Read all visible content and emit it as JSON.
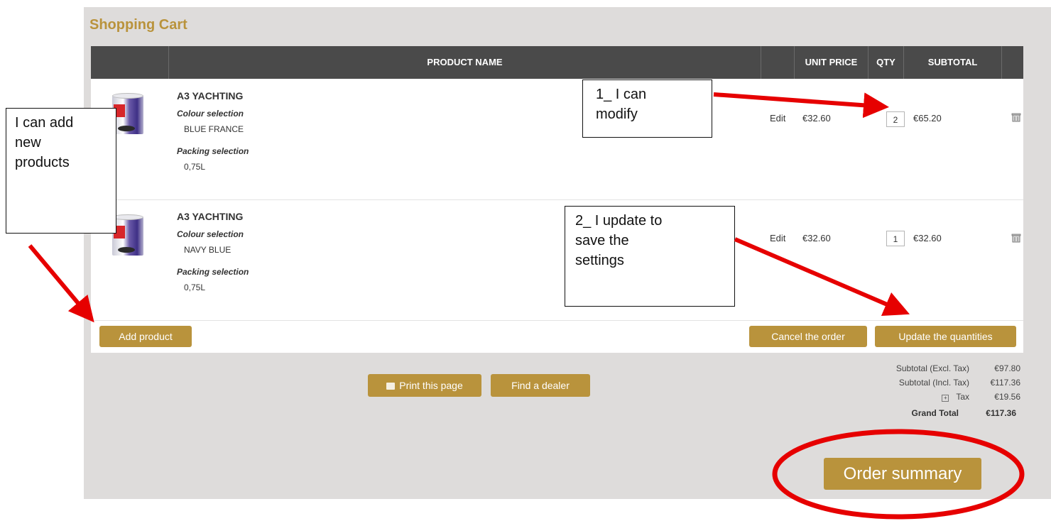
{
  "page": {
    "title": "Shopping Cart"
  },
  "table": {
    "headers": {
      "product_name": "PRODUCT NAME",
      "unit_price": "UNIT PRICE",
      "qty": "QTY",
      "subtotal": "SUBTOTAL"
    },
    "rows": [
      {
        "name": "A3 YACHTING",
        "colour_label": "Colour selection",
        "colour_value": "BLUE FRANCE",
        "packing_label": "Packing selection",
        "packing_value": "0,75L",
        "edit": "Edit",
        "unit_price": "€32.60",
        "qty": "2",
        "subtotal": "€65.20"
      },
      {
        "name": "A3 YACHTING",
        "colour_label": "Colour selection",
        "colour_value": "NAVY BLUE",
        "packing_label": "Packing selection",
        "packing_value": "0,75L",
        "edit": "Edit",
        "unit_price": "€32.60",
        "qty": "1",
        "subtotal": "€32.60"
      }
    ]
  },
  "actions": {
    "add_product": "Add product",
    "cancel_order": "Cancel the order",
    "update_quantities": "Update the quantities"
  },
  "footer_buttons": {
    "print": "Print this page",
    "dealer": "Find a dealer"
  },
  "totals": {
    "subtotal_excl_label": "Subtotal (Excl. Tax)",
    "subtotal_excl_value": "€97.80",
    "subtotal_incl_label": "Subtotal (Incl. Tax)",
    "subtotal_incl_value": "€117.36",
    "tax_label": "Tax",
    "tax_value": "€19.56",
    "grand_total_label": "Grand Total",
    "grand_total_value": "€117.36"
  },
  "order_summary": "Order summary",
  "annotations": {
    "add_products": [
      "I can add",
      "new",
      "products"
    ],
    "modify": [
      "1_ I can",
      "modify"
    ],
    "update": [
      "2_ I update to",
      "save the",
      "settings"
    ]
  },
  "colors": {
    "gold": "#b9933c",
    "header": "#4a4a4a",
    "annotation_red": "#e60000",
    "panel": "#dedcdb"
  }
}
